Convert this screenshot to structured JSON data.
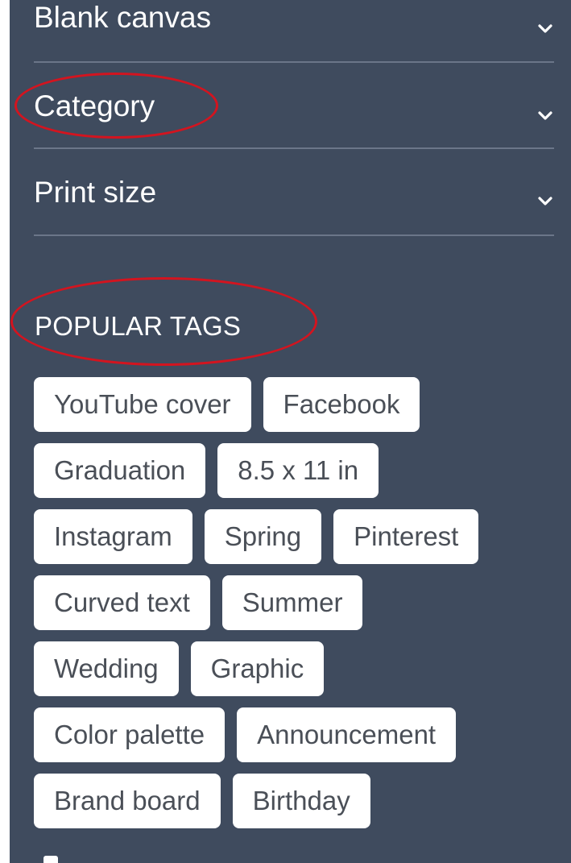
{
  "filters": [
    {
      "label": "Blank canvas",
      "icon": "chevron-down-icon"
    },
    {
      "label": "Category",
      "icon": "chevron-down-icon"
    },
    {
      "label": "Print size",
      "icon": "chevron-down-icon"
    }
  ],
  "popular_tags": {
    "title": "POPULAR TAGS",
    "rows": [
      [
        "YouTube cover",
        "Facebook"
      ],
      [
        "Graduation",
        "8.5 x 11 in"
      ],
      [
        "Instagram",
        "Spring",
        "Pinterest"
      ],
      [
        "Curved text",
        "Summer"
      ],
      [
        "Wedding",
        "Graphic"
      ],
      [
        "Color palette",
        "Announcement"
      ],
      [
        "Brand board",
        "Birthday"
      ]
    ]
  },
  "colors": {
    "panel_bg": "#3f4b5e",
    "divider": "#6b7689",
    "tag_bg": "#ffffff",
    "tag_text": "#4a4f57",
    "annotation": "#d3141f"
  }
}
